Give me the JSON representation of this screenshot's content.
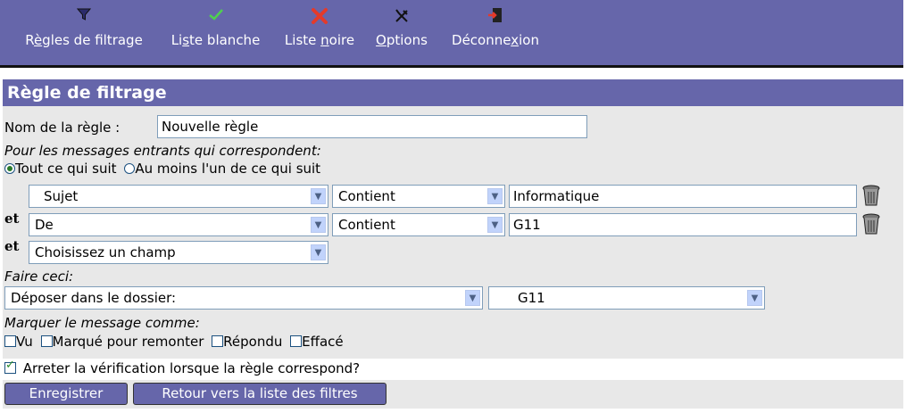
{
  "nav": {
    "items": [
      {
        "label_pre": "R",
        "label_u": "è",
        "label_post": "gles de filtrage",
        "icon": "funnel-icon"
      },
      {
        "label_pre": "Li",
        "label_u": "s",
        "label_post": "te blanche",
        "icon": "checkmark-icon"
      },
      {
        "label_pre": "Liste ",
        "label_u": "n",
        "label_post": "oire",
        "icon": "red-x-icon"
      },
      {
        "label_pre": "",
        "label_u": "O",
        "label_post": "ptions",
        "icon": "tools-icon"
      },
      {
        "label_pre": "Déconne",
        "label_u": "x",
        "label_post": "ion",
        "icon": "logout-icon"
      }
    ]
  },
  "form": {
    "title": "Règle de filtrage",
    "rule_name_label": "Nom de la règle :",
    "rule_name_value": "Nouvelle règle",
    "incoming_label": "Pour les messages entrants qui correspondent:",
    "match_all_label": "Tout ce qui suit",
    "match_any_label": "Au moins l'un de ce qui suit",
    "conditions": [
      {
        "prefix": "",
        "field": "Sujet",
        "operator": "Contient",
        "value": "Informatique"
      },
      {
        "prefix": "et",
        "field": "De",
        "operator": "Contient",
        "value": "G11"
      }
    ],
    "new_condition": {
      "prefix": "et",
      "field": "Choisissez un champ"
    },
    "action_label": "Faire ceci:",
    "action_value": "Déposer dans le dossier:",
    "folder_value": "G11",
    "mark_label": "Marquer le message comme:",
    "flags": [
      {
        "label": "Vu",
        "checked": false
      },
      {
        "label": "Marqué pour remonter",
        "checked": false
      },
      {
        "label": "Répondu",
        "checked": false
      },
      {
        "label": "Effacé",
        "checked": false
      }
    ],
    "stop_label": "Arreter la vérification lorsque la règle correspond?",
    "stop_checked": true,
    "save_label": "Enregistrer",
    "back_label": "Retour vers la liste des filtres"
  }
}
